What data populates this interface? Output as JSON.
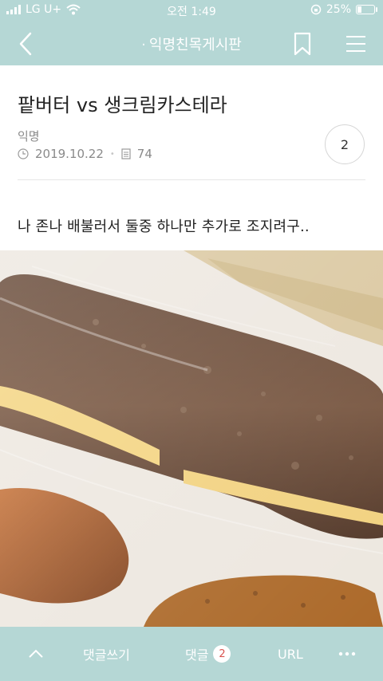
{
  "status_bar": {
    "carrier": "LG U+",
    "time": "오전 1:49",
    "battery_percent": "25%",
    "battery_level": 0.25
  },
  "nav": {
    "title": "익명친목게시판",
    "back_icon": "chevron-left-icon",
    "bookmark_icon": "bookmark-icon",
    "menu_icon": "hamburger-menu-icon"
  },
  "post": {
    "title": "팥버터 vs 생크림카스테라",
    "author": "익명",
    "date": "2019.10.22",
    "views": "74",
    "comment_count": "2",
    "body": "나 존나 배불러서 둘중 하나만 추가로 조지려구.."
  },
  "bottom_bar": {
    "scroll_top_icon": "chevron-up-icon",
    "write_comment": "댓글쓰기",
    "comments_label": "댓글",
    "comments_count": "2",
    "url": "URL",
    "more_icon": "more-dots-icon"
  },
  "colors": {
    "accent": "#b5d7d5",
    "text": "#222222",
    "meta": "#8a8a8a",
    "badge_text": "#d9534f"
  }
}
